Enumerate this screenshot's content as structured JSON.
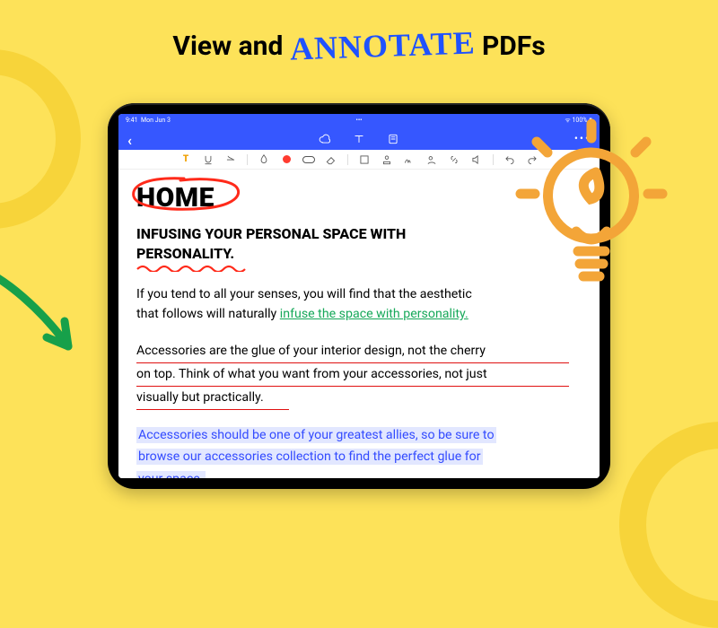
{
  "headline": {
    "pre": "View and ",
    "annotate": "ANNOTATE",
    "post": " PDFs"
  },
  "statusbar": {
    "time": "9:41",
    "day": "Mon Jun 3",
    "battery": "100%"
  },
  "topbar": {
    "back": "‹",
    "more": "•••"
  },
  "toolstrip": {
    "text_T": "T"
  },
  "doc": {
    "home": "HOME",
    "subhead_line1": "INFUSING YOUR PERSONAL SPACE WITH",
    "subhead_line2": "PERSONALITY.",
    "p1_a": "If you tend to all your senses, you will find that the aesthetic",
    "p1_b_plain": "that follows will naturally ",
    "p1_b_green": "infuse the space with personality.",
    "p2_l1": "Accessories are the glue of your interior design, not the cherry",
    "p2_l2": "on top. Think of what you want from your accessories, not just",
    "p2_l3": "visually but practically.",
    "p3_l1": "Accessories should be one of your greatest allies, so be sure to",
    "p3_l2": "browse our accessories collection to find the perfect glue for",
    "p3_l3": "your space."
  }
}
